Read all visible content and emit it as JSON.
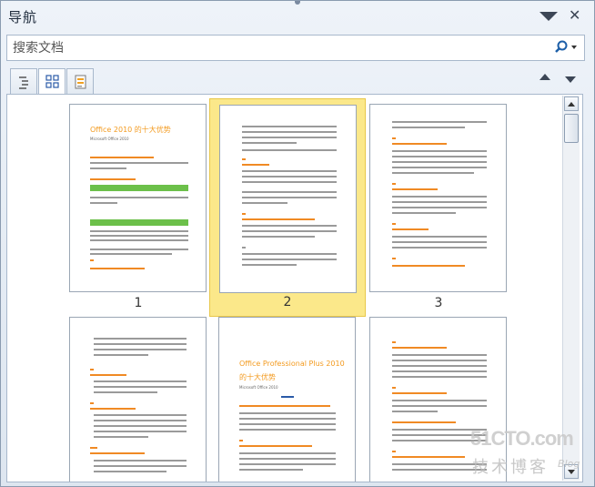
{
  "panel": {
    "title": "导航"
  },
  "search": {
    "placeholder": "搜索文档"
  },
  "pages": [
    {
      "number": "1",
      "title": "Office 2010 的十大优势",
      "subtitle": "Microsoft Office 2010",
      "selected": false
    },
    {
      "number": "2",
      "selected": true
    },
    {
      "number": "3",
      "selected": false
    },
    {
      "number": "",
      "selected": false
    },
    {
      "number": "",
      "title_line1": "Office Professional Plus 2010",
      "title_line2": "的十大优势",
      "subtitle": "Microsoft Office 2010",
      "selected": false
    },
    {
      "number": "",
      "selected": false
    }
  ],
  "watermark": {
    "line1": "51CTO.com",
    "line2": "技术博客",
    "line3": "Blog"
  }
}
